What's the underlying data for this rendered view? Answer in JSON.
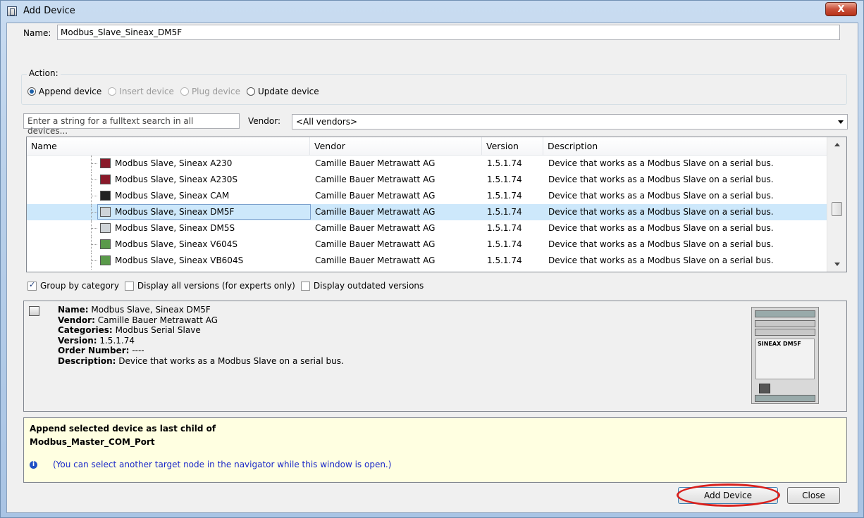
{
  "window": {
    "title": "Add Device",
    "close_glyph": "X"
  },
  "name_field": {
    "label": "Name:",
    "value": "Modbus_Slave_Sineax_DM5F"
  },
  "action": {
    "legend": "Action:",
    "options": [
      {
        "label": "Append device",
        "selected": true,
        "enabled": true
      },
      {
        "label": "Insert device",
        "selected": false,
        "enabled": false
      },
      {
        "label": "Plug device",
        "selected": false,
        "enabled": false
      },
      {
        "label": "Update device",
        "selected": false,
        "enabled": true
      }
    ]
  },
  "search": {
    "placeholder": "Enter a string for a fulltext search in all devices..."
  },
  "vendor": {
    "label": "Vendor:",
    "value": "<All vendors>"
  },
  "table": {
    "columns": [
      "Name",
      "Vendor",
      "Version",
      "Description"
    ],
    "rows": [
      {
        "name": "Modbus Slave, Sineax A230",
        "vendor": "Camille Bauer Metrawatt AG",
        "version": "1.5.1.74",
        "description": "Device that works as a Modbus Slave on a serial bus.",
        "icon": "device-red-icon"
      },
      {
        "name": "Modbus Slave, Sineax A230S",
        "vendor": "Camille Bauer Metrawatt AG",
        "version": "1.5.1.74",
        "description": "Device that works as a Modbus Slave on a serial bus.",
        "icon": "device-red-icon"
      },
      {
        "name": "Modbus Slave, Sineax CAM",
        "vendor": "Camille Bauer Metrawatt AG",
        "version": "1.5.1.74",
        "description": "Device that works as a Modbus Slave on a serial bus.",
        "icon": "device-black-icon"
      },
      {
        "name": "Modbus Slave, Sineax DM5F",
        "vendor": "Camille Bauer Metrawatt AG",
        "version": "1.5.1.74",
        "description": "Device that works as a Modbus Slave on a serial bus.",
        "icon": "device-grey-icon",
        "selected": true
      },
      {
        "name": "Modbus Slave, Sineax DM5S",
        "vendor": "Camille Bauer Metrawatt AG",
        "version": "1.5.1.74",
        "description": "Device that works as a Modbus Slave on a serial bus.",
        "icon": "device-grey-icon"
      },
      {
        "name": "Modbus Slave, Sineax V604S",
        "vendor": "Camille Bauer Metrawatt AG",
        "version": "1.5.1.74",
        "description": "Device that works as a Modbus Slave on a serial bus.",
        "icon": "device-green-icon"
      },
      {
        "name": "Modbus Slave, Sineax VB604S",
        "vendor": "Camille Bauer Metrawatt AG",
        "version": "1.5.1.74",
        "description": "Device that works as a Modbus Slave on a serial bus.",
        "icon": "device-green-icon"
      }
    ]
  },
  "options": [
    {
      "label": "Group by category",
      "checked": true
    },
    {
      "label": "Display all versions (for experts only)",
      "checked": false
    },
    {
      "label": "Display outdated versions",
      "checked": false
    }
  ],
  "info": {
    "name_label": "Name:",
    "name_value": "Modbus Slave, Sineax DM5F",
    "vendor_label": "Vendor:",
    "vendor_value": "Camille Bauer Metrawatt AG",
    "categories_label": "Categories:",
    "categories_value": "Modbus Serial Slave",
    "version_label": "Version:",
    "version_value": "1.5.1.74",
    "order_label": "Order Number:",
    "order_value": "----",
    "description_label": "Description:",
    "description_value": "Device that works as a Modbus Slave on a serial bus.",
    "image_label": "SINEAX DM5F"
  },
  "target": {
    "line1": "Append selected device as last child of",
    "line2": "Modbus_Master_COM_Port",
    "note": "(You can select another target node in the navigator while this window is open.)"
  },
  "buttons": {
    "add": "Add Device",
    "close": "Close"
  },
  "colors": {
    "highlight": "#d9201c",
    "selection": "#cde8fb",
    "note_text": "#1a28c8",
    "target_bg": "#ffffe1"
  }
}
